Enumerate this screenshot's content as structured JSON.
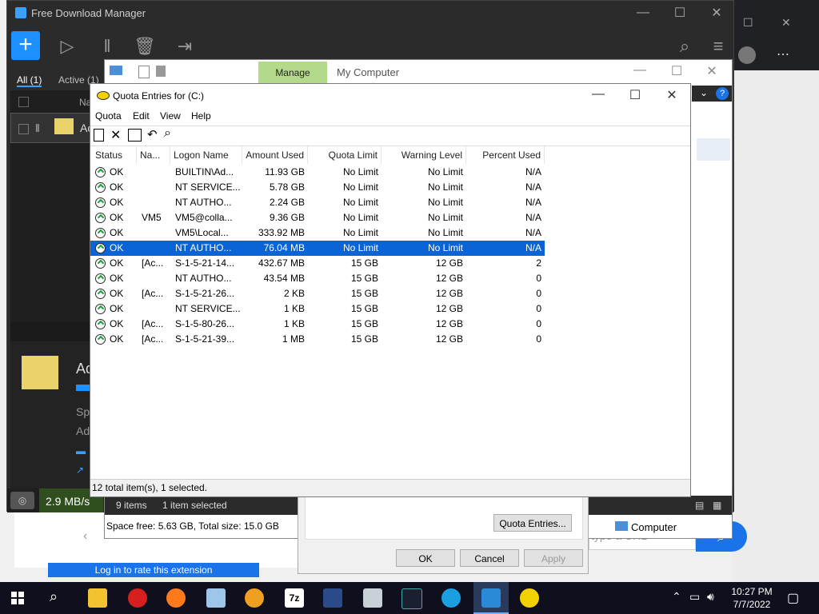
{
  "fdm": {
    "title": "Free Download Manager",
    "tab_all": "All (1)",
    "tab_active": "Active (1)",
    "col_name": "Na",
    "item_name": "Ac",
    "detail_name": "Ad",
    "detail_speed": "Spe",
    "detail_added": "Add",
    "speed": "2.9 MB/s",
    "items_count": "9 items",
    "selected": "1 item selected"
  },
  "mgmt": {
    "manage_tab": "Manage",
    "title": "My Computer",
    "space_free": "Space free: 5.63 GB, Total size: 15.0 GB",
    "computer_label": "Computer"
  },
  "props": {
    "quota_entries_btn": "Quota Entries...",
    "ok": "OK",
    "cancel": "Cancel",
    "apply": "Apply"
  },
  "browser": {
    "url_placeholder": "type a URL",
    "rate_text": "Log in to rate this extension"
  },
  "quota": {
    "title": "Quota Entries for  (C:)",
    "menu": [
      "Quota",
      "Edit",
      "View",
      "Help"
    ],
    "columns": [
      "Status",
      "Na...",
      "Logon Name",
      "Amount Used",
      "Quota Limit",
      "Warning Level",
      "Percent Used"
    ],
    "rows": [
      {
        "status": "OK",
        "name": "",
        "logon": "BUILTIN\\Ad...",
        "amount": "11.93 GB",
        "quota": "No Limit",
        "warning": "No Limit",
        "percent": "N/A"
      },
      {
        "status": "OK",
        "name": "",
        "logon": "NT SERVICE...",
        "amount": "5.78 GB",
        "quota": "No Limit",
        "warning": "No Limit",
        "percent": "N/A"
      },
      {
        "status": "OK",
        "name": "",
        "logon": "NT AUTHO...",
        "amount": "2.24 GB",
        "quota": "No Limit",
        "warning": "No Limit",
        "percent": "N/A"
      },
      {
        "status": "OK",
        "name": "VM5",
        "logon": "VM5@colla...",
        "amount": "9.36 GB",
        "quota": "No Limit",
        "warning": "No Limit",
        "percent": "N/A"
      },
      {
        "status": "OK",
        "name": "",
        "logon": "VM5\\Local...",
        "amount": "333.92 MB",
        "quota": "No Limit",
        "warning": "No Limit",
        "percent": "N/A"
      },
      {
        "status": "OK",
        "name": "",
        "logon": "NT AUTHO...",
        "amount": "76.04 MB",
        "quota": "No Limit",
        "warning": "No Limit",
        "percent": "N/A"
      },
      {
        "status": "OK",
        "name": "[Ac...",
        "logon": "S-1-5-21-14...",
        "amount": "432.67 MB",
        "quota": "15 GB",
        "warning": "12 GB",
        "percent": "2"
      },
      {
        "status": "OK",
        "name": "",
        "logon": "NT AUTHO...",
        "amount": "43.54 MB",
        "quota": "15 GB",
        "warning": "12 GB",
        "percent": "0"
      },
      {
        "status": "OK",
        "name": "[Ac...",
        "logon": "S-1-5-21-26...",
        "amount": "2 KB",
        "quota": "15 GB",
        "warning": "12 GB",
        "percent": "0"
      },
      {
        "status": "OK",
        "name": "",
        "logon": "NT SERVICE...",
        "amount": "1 KB",
        "quota": "15 GB",
        "warning": "12 GB",
        "percent": "0"
      },
      {
        "status": "OK",
        "name": "[Ac...",
        "logon": "S-1-5-80-26...",
        "amount": "1 KB",
        "quota": "15 GB",
        "warning": "12 GB",
        "percent": "0"
      },
      {
        "status": "OK",
        "name": "[Ac...",
        "logon": "S-1-5-21-39...",
        "amount": "1 MB",
        "quota": "15 GB",
        "warning": "12 GB",
        "percent": "0"
      }
    ],
    "selected_index": 5,
    "status_text": "12 total item(s), 1 selected."
  },
  "taskbar": {
    "time": "10:27 PM",
    "date": "7/7/2022",
    "icons": [
      "start-icon",
      "search-icon",
      "file-explorer-icon",
      "power-app-icon",
      "firefox-icon",
      "notepad-icon",
      "media-app-icon",
      "7zip-icon",
      "screen-recorder-icon",
      "network-app-icon",
      "terminal-icon",
      "edge-icon",
      "fdm-icon",
      "pacman-icon"
    ]
  }
}
